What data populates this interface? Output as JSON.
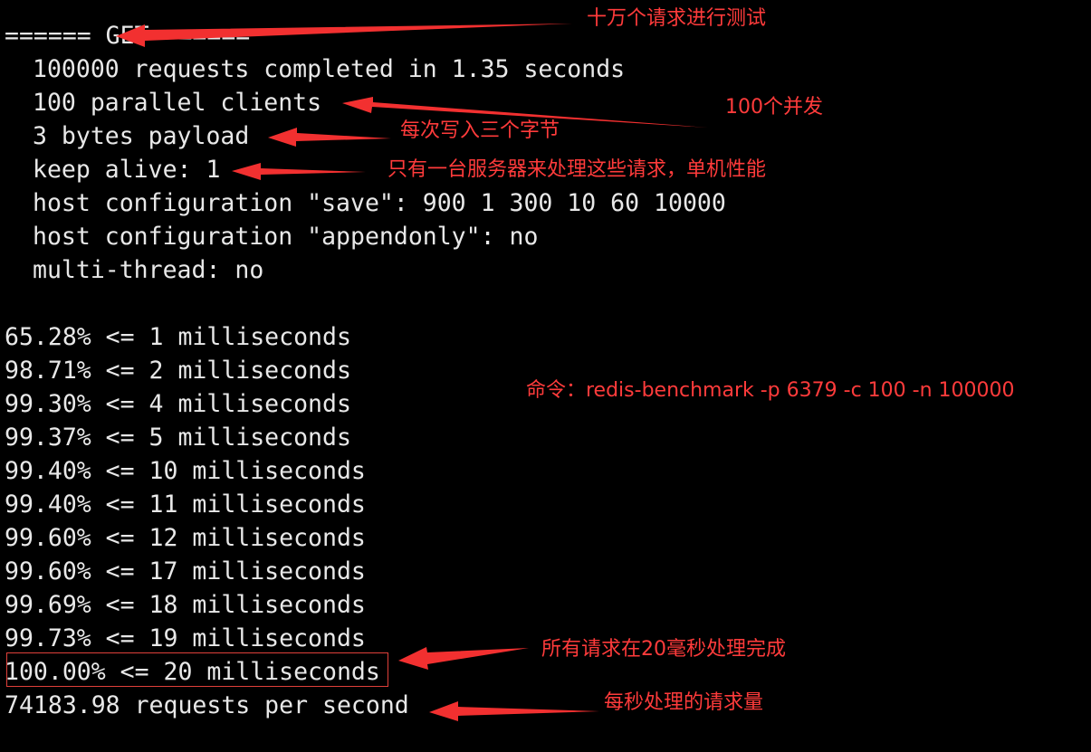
{
  "terminal": {
    "header": "====== GET ======",
    "summary": [
      "100000 requests completed in 1.35 seconds",
      "100 parallel clients",
      "3 bytes payload",
      "keep alive: 1",
      "host configuration \"save\": 900 1 300 10 60 10000",
      "host configuration \"appendonly\": no",
      "multi-thread: no"
    ],
    "latency": [
      "65.28% <= 1 milliseconds",
      "98.71% <= 2 milliseconds",
      "99.30% <= 4 milliseconds",
      "99.37% <= 5 milliseconds",
      "99.40% <= 10 milliseconds",
      "99.40% <= 11 milliseconds",
      "99.60% <= 12 milliseconds",
      "99.60% <= 17 milliseconds",
      "99.69% <= 18 milliseconds",
      "99.73% <= 19 milliseconds",
      "100.00% <= 20 milliseconds"
    ],
    "throughput": "74183.98 requests per second"
  },
  "annotations": {
    "requests_note": "十万个请求进行测试",
    "parallel_note": "100个并发",
    "payload_note": "每次写入三个字节",
    "keepalive_note": "只有一台服务器来处理这些请求，单机性能",
    "command_note": "命令：redis-benchmark -p 6379 -c 100 -n 100000",
    "complete_note": "所有请求在20毫秒处理完成",
    "throughput_note": "每秒处理的请求量"
  },
  "colors": {
    "background": "#000000",
    "terminal_text": "#e8e8e8",
    "annotation": "#ff3b3b"
  }
}
